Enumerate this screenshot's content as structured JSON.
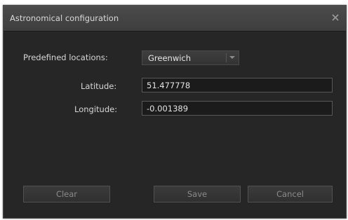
{
  "dialog": {
    "title": "Astronomical configuration",
    "close_icon": "close-icon"
  },
  "form": {
    "predefined_label": "Predefined locations:",
    "predefined_value": "Greenwich",
    "latitude_label": "Latitude:",
    "latitude_value": "51.477778",
    "longitude_label": "Longitude:",
    "longitude_value": "-0.001389"
  },
  "buttons": {
    "clear": "Clear",
    "save": "Save",
    "cancel": "Cancel"
  },
  "colors": {
    "dialog_bg": "#262626",
    "titlebar": "#444444",
    "field_bg": "#1b1b1b",
    "button_text": "#8a8a8a"
  }
}
